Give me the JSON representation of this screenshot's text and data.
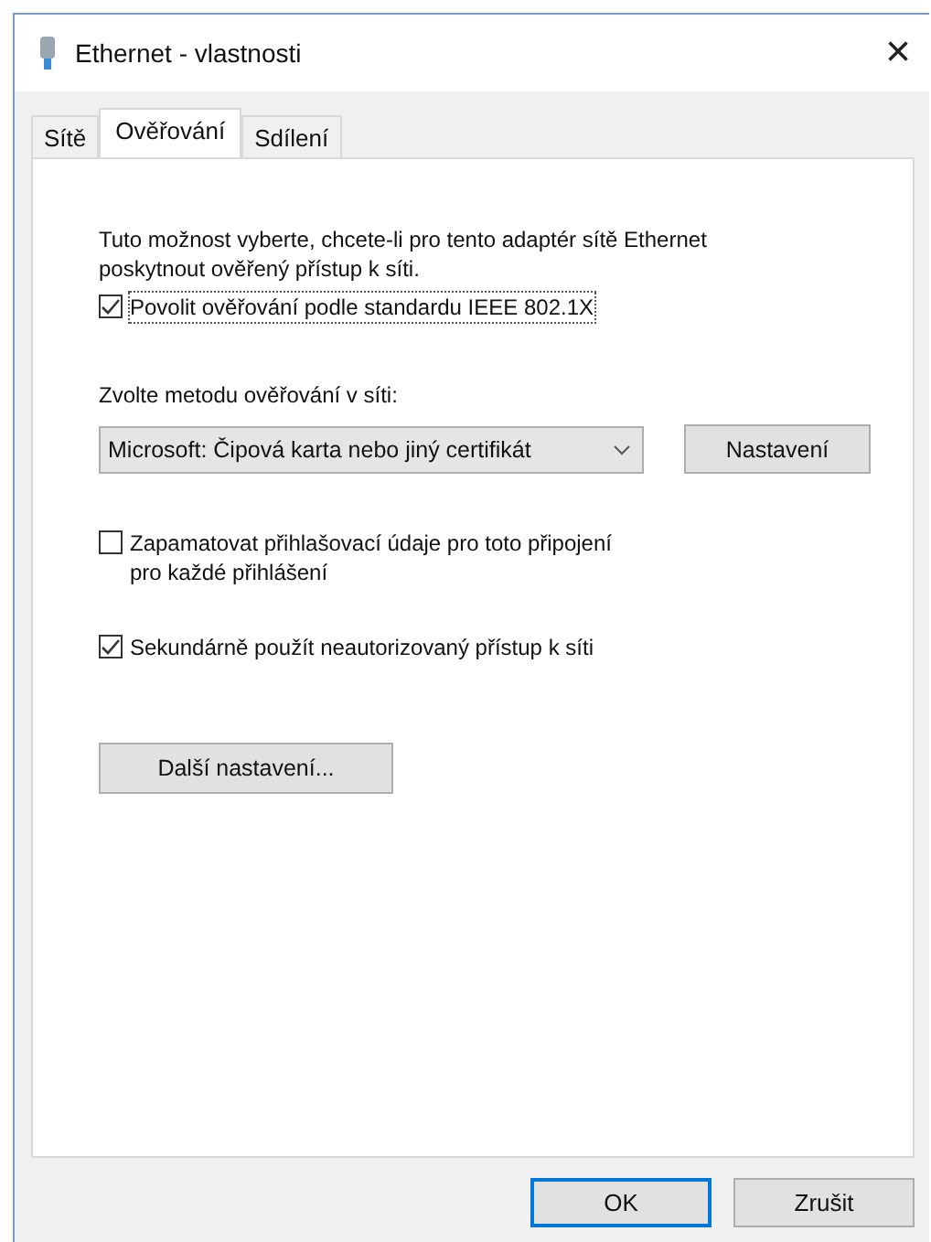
{
  "window": {
    "title": "Ethernet - vlastnosti",
    "close": "×"
  },
  "tabs": [
    {
      "label": "Sítě",
      "selected": false
    },
    {
      "label": "Ověřování",
      "selected": true
    },
    {
      "label": "Sdílení",
      "selected": false
    }
  ],
  "intro": "Tuto možnost vyberte, chcete-li pro tento adaptér sítě Ethernet poskytnout ověřený přístup k síti.",
  "enable_8021x": {
    "label": "Povolit ověřování podle standardu IEEE 802.1X",
    "checked": true,
    "focused": true
  },
  "method": {
    "label": "Zvolte metodu ověřování v síti:",
    "value": "Microsoft: Čipová karta nebo jiný certifikát",
    "button": "Nastavení"
  },
  "options": [
    {
      "label": "Zapamatovat přihlašovací údaje pro toto připojení\npro každé přihlášení",
      "checked": false
    },
    {
      "label": "Sekundárně použít neautorizovaný přístup k síti",
      "checked": true
    }
  ],
  "more_button": "Další nastavení...",
  "buttons": [
    {
      "label": "OK",
      "default": true
    },
    {
      "label": "Zrušit",
      "default": false
    }
  ]
}
